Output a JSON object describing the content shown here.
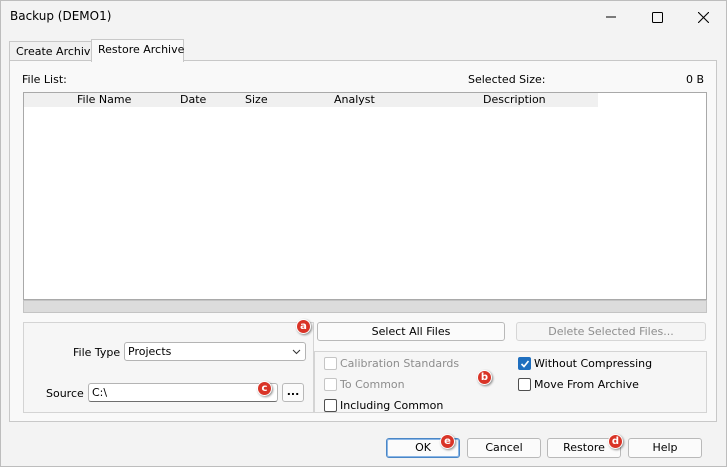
{
  "window": {
    "title": "Backup (DEMO1)"
  },
  "tabs": [
    {
      "label": "Create Archive"
    },
    {
      "label": "Restore Archive"
    }
  ],
  "file_list": {
    "label": "File List:",
    "selected_size_label": "Selected Size:",
    "selected_size_value": "0 B",
    "columns": [
      "File Name",
      "Date",
      "Size",
      "Analyst",
      "Description"
    ],
    "rows": []
  },
  "buttons": {
    "select_all": "Select All Files",
    "delete_selected": "Delete Selected Files...",
    "browse": "...",
    "ok": "OK",
    "cancel": "Cancel",
    "restore": "Restore",
    "help": "Help"
  },
  "file_type": {
    "label": "File Type",
    "value": "Projects"
  },
  "source": {
    "label": "Source",
    "value": "C:\\"
  },
  "options": {
    "calibration_standards": {
      "label": "Calibration Standards",
      "checked": false,
      "enabled": false
    },
    "to_common": {
      "label": "To Common",
      "checked": false,
      "enabled": false
    },
    "including_common": {
      "label": "Including Common",
      "checked": false,
      "enabled": true
    },
    "without_compressing": {
      "label": "Without Compressing",
      "checked": true,
      "enabled": true
    },
    "move_from_archive": {
      "label": "Move From Archive",
      "checked": false,
      "enabled": true
    }
  },
  "annotations": {
    "a": "a",
    "b": "b",
    "c": "c",
    "d": "d",
    "e": "e"
  },
  "colors": {
    "accent": "#1f6fbf",
    "badge": "#d93427"
  }
}
